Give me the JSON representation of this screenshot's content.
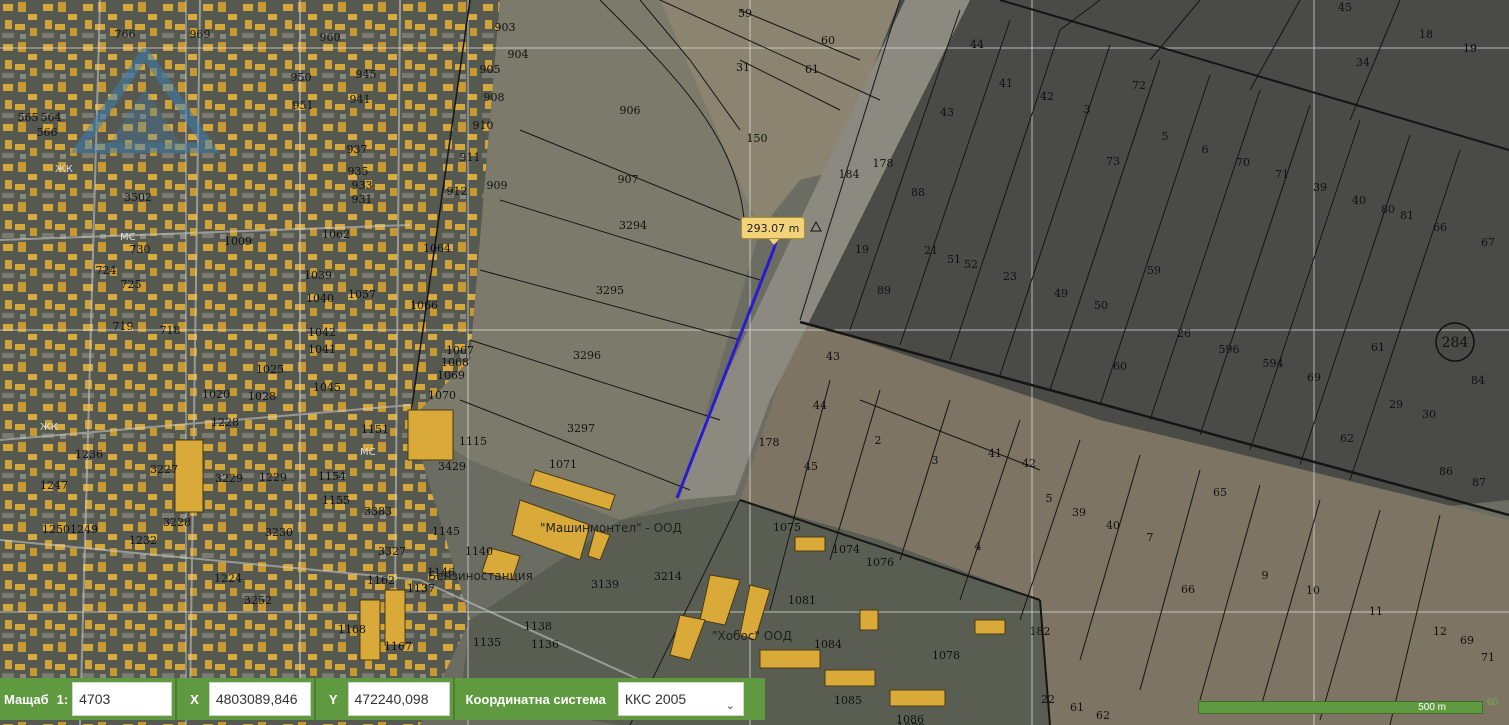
{
  "map": {
    "measurement": "293.07 m",
    "parcels_city": [
      "766",
      "969",
      "960",
      "903",
      "904",
      "905",
      "908",
      "910",
      "911",
      "912",
      "909",
      "950",
      "951",
      "941",
      "945",
      "937",
      "935",
      "933",
      "931",
      "3502",
      "730",
      "1009",
      "1062",
      "1064",
      "1066",
      "724",
      "725",
      "719",
      "718",
      "1039",
      "1040",
      "1057",
      "1042",
      "1041",
      "1045",
      "1025",
      "1020",
      "1028",
      "1228",
      "1236",
      "1247",
      "1250",
      "1249",
      "1232",
      "3227",
      "3229",
      "3228",
      "1229",
      "1154",
      "1155",
      "3230",
      "3383",
      "3327",
      "3429",
      "1151",
      "1115",
      "1145",
      "1140",
      "1146",
      "1067",
      "1068",
      "1069",
      "1070",
      "1071",
      "3214",
      "3139",
      "1224",
      "3252",
      "1162",
      "1137",
      "1138",
      "1135",
      "1136",
      "1168",
      "1167",
      "1081",
      "1084",
      "1078",
      "1085",
      "1086",
      "1075",
      "1074",
      "1076",
      "1078",
      "565",
      "564",
      "566"
    ],
    "parcels_field": [
      "59",
      "60",
      "61",
      "31",
      "150",
      "906",
      "907",
      "3294",
      "3295",
      "3296",
      "3297",
      "184",
      "178",
      "19",
      "89",
      "21",
      "51",
      "52",
      "23",
      "49",
      "50",
      "88",
      "44",
      "41",
      "42",
      "3",
      "43",
      "72",
      "73",
      "5",
      "6",
      "70",
      "71",
      "39",
      "40",
      "80",
      "81",
      "66",
      "67",
      "45",
      "34",
      "18",
      "19",
      "59",
      "26",
      "596",
      "594",
      "69",
      "61",
      "29",
      "30",
      "84",
      "86",
      "87",
      "62",
      "60",
      "43",
      "44",
      "178",
      "45",
      "2",
      "3",
      "41",
      "42",
      "5",
      "39",
      "40",
      "7",
      "4",
      "65",
      "66",
      "9",
      "10",
      "11",
      "12",
      "69",
      "71",
      "22",
      "61",
      "62",
      "182"
    ],
    "circled_parcel": "284",
    "street_labels": [
      "ЖК",
      "МС",
      "ЖК",
      "МС"
    ],
    "company_label": "\"Машинмонтел\" - ООД",
    "company_label_2": "\"Хобос\" ООД",
    "company_label_3": "Бензиностанция"
  },
  "toolbar": {
    "scale_label": "Мащаб",
    "scale_prefix": "1:",
    "scale_value": "4703",
    "x_label": "X",
    "x_value": "4803089,846",
    "y_label": "Y",
    "y_value": "472240,098",
    "coord_system_label": "Координатна система",
    "coord_system_value": "ККС 2005"
  },
  "scalebar": {
    "label": "500 m",
    "edge_text": "60"
  },
  "colors": {
    "toolbar_bg": "#5f9a40",
    "measure_line": "#2b1bd0",
    "building": "#d9aa3a",
    "tooltip_bg": "#f3d37a"
  }
}
